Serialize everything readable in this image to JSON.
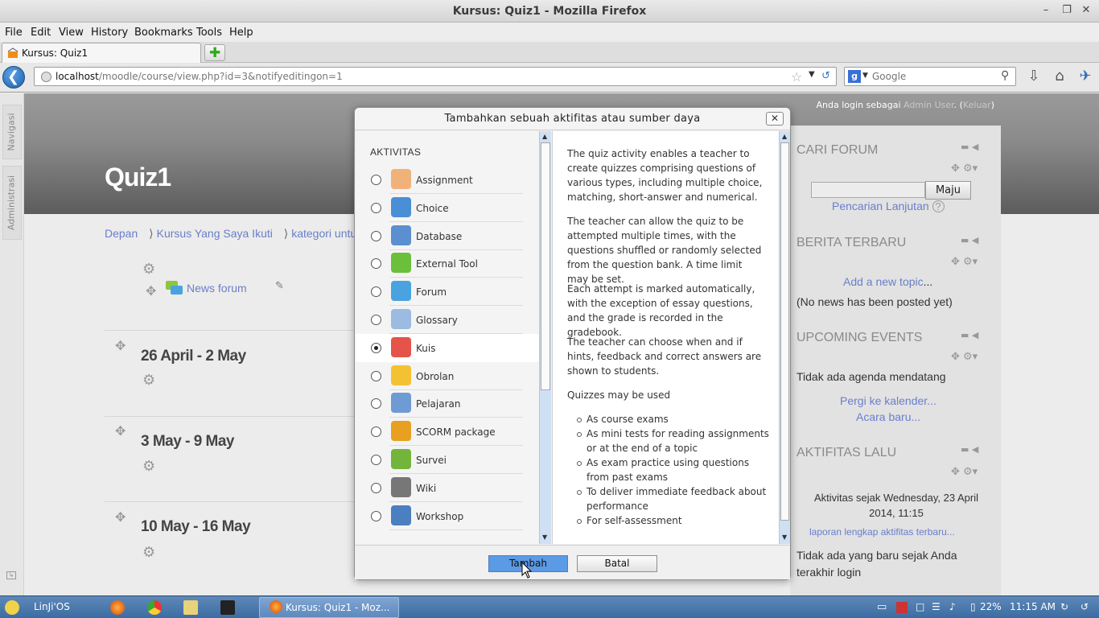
{
  "window": {
    "title": "Kursus: Quiz1 - Mozilla Firefox"
  },
  "menu": {
    "items": [
      "File",
      "Edit",
      "View",
      "History",
      "Bookmarks",
      "Tools",
      "Help"
    ]
  },
  "tabs": [
    {
      "label": "Kursus: Quiz1"
    }
  ],
  "urlbar": {
    "host": "localhost",
    "path": "/moodle/course/view.php?id=3&notifyeditingon=1"
  },
  "search": {
    "placeholder": "Google"
  },
  "dock": {
    "items": [
      "Navigasi",
      "Administrasi"
    ]
  },
  "header": {
    "login_prefix": "Anda login sebagai",
    "login_user": "Admin User",
    "login_open": ". (",
    "logout": "Keluar",
    "login_close": ")",
    "course_title": "Quiz1"
  },
  "breadcrumb": [
    "Depan",
    "Kursus Yang Saya Ikuti",
    "kategori untuk"
  ],
  "course": {
    "news_forum": "News forum",
    "weeks": [
      "26 April - 2 May",
      "3 May - 9 May",
      "10 May - 16 May"
    ]
  },
  "blocks": {
    "search_forum": {
      "title": "CARI FORUM",
      "button": "Maju",
      "advanced": "Pencarian Lanjutan"
    },
    "latest_news": {
      "title": "BERITA TERBARU",
      "add_topic": "Add a new topic",
      "ellipsis": "...",
      "empty": "(No news has been posted yet)"
    },
    "upcoming": {
      "title": "UPCOMING EVENTS",
      "empty": "Tidak ada agenda mendatang",
      "calendar": "Pergi ke kalender...",
      "new_event": "Acara baru..."
    },
    "recent": {
      "title": "AKTIFITAS LALU",
      "since": "Aktivitas sejak Wednesday, 23 April 2014, 11:15",
      "full_report": "laporan lengkap aktifitas terbaru...",
      "none": "Tidak ada yang baru sejak Anda terakhir login"
    }
  },
  "dialog": {
    "title": "Tambahkan sebuah aktifitas atau sumber daya",
    "section": "AKTIVITAS",
    "options": [
      {
        "label": "Assignment",
        "icon": "assignment-icon",
        "selected": false
      },
      {
        "label": "Choice",
        "icon": "choice-icon",
        "selected": false
      },
      {
        "label": "Database",
        "icon": "database-icon",
        "selected": false
      },
      {
        "label": "External Tool",
        "icon": "external-tool-icon",
        "selected": false
      },
      {
        "label": "Forum",
        "icon": "forum-icon",
        "selected": false
      },
      {
        "label": "Glossary",
        "icon": "glossary-icon",
        "selected": false
      },
      {
        "label": "Kuis",
        "icon": "quiz-icon",
        "selected": true
      },
      {
        "label": "Obrolan",
        "icon": "chat-icon",
        "selected": false
      },
      {
        "label": "Pelajaran",
        "icon": "lesson-icon",
        "selected": false
      },
      {
        "label": "SCORM package",
        "icon": "scorm-icon",
        "selected": false
      },
      {
        "label": "Survei",
        "icon": "survey-icon",
        "selected": false
      },
      {
        "label": "Wiki",
        "icon": "wiki-icon",
        "selected": false
      },
      {
        "label": "Workshop",
        "icon": "workshop-icon",
        "selected": false
      }
    ],
    "description": [
      "The quiz activity enables a teacher to create quizzes comprising questions of various types, including multiple choice, matching, short-answer and numerical.",
      "The teacher can allow the quiz to be attempted multiple times, with the questions shuffled or randomly selected from the question bank. A time limit may be set.",
      "Each attempt is marked automatically, with the exception of essay questions, and the grade is recorded in the gradebook.",
      "The teacher can choose when and if hints, feedback and correct answers are shown to students.",
      "Quizzes may be used"
    ],
    "uses": [
      "As course exams",
      "As mini tests for reading assignments or at the end of a topic",
      "As exam practice using questions from past exams",
      "To deliver immediate feedback about performance",
      "For self-assessment"
    ],
    "add_button": "Tambah",
    "cancel_button": "Batal"
  },
  "taskbar": {
    "start_label": "LinJi'OS",
    "window_label": "Kursus: Quiz1 - Moz...",
    "battery": "22%",
    "clock": "11:15 AM"
  },
  "colors": {
    "accent_link": "#6a7ecb",
    "selected_button": "#5b9ae5",
    "taskbar": "#4a7aae"
  }
}
